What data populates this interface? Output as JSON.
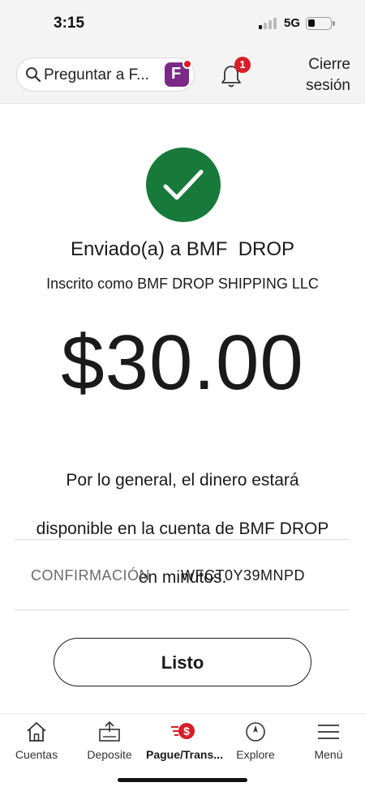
{
  "status_bar": {
    "time": "3:15",
    "network": "5G"
  },
  "header": {
    "search_placeholder": "Preguntar a F...",
    "notification_count": "1",
    "logout_line1": "Cierre",
    "logout_line2": "sesión",
    "icons": [
      "search-icon",
      "fargo-assistant-icon",
      "bell-icon"
    ]
  },
  "confirmation": {
    "sent_to": "Enviado(a) a BMF  DROP",
    "enrolled_as": "Inscrito como BMF DROP SHIPPING LLC",
    "amount": "$30.00",
    "availability_line1": "Por lo general, el dinero estará",
    "availability_line2": "disponible en la cuenta de BMF  DROP",
    "availability_line3": "en minutos.",
    "label": "CONFIRMACIÓN",
    "code": "WFCT0Y39MNPD",
    "done_label": "Listo"
  },
  "bottom_nav": {
    "items": [
      {
        "label": "Cuentas",
        "icon": "home-icon"
      },
      {
        "label": "Deposite",
        "icon": "deposit-icon"
      },
      {
        "label": "Pague/Trans...",
        "icon": "pay-transfer-icon",
        "active": true
      },
      {
        "label": "Explore",
        "icon": "compass-icon"
      },
      {
        "label": "Menú",
        "icon": "menu-icon"
      }
    ]
  },
  "colors": {
    "success_green": "#177a3a",
    "brand_red": "#d71e28",
    "assistant_purple": "#7a2a86"
  }
}
